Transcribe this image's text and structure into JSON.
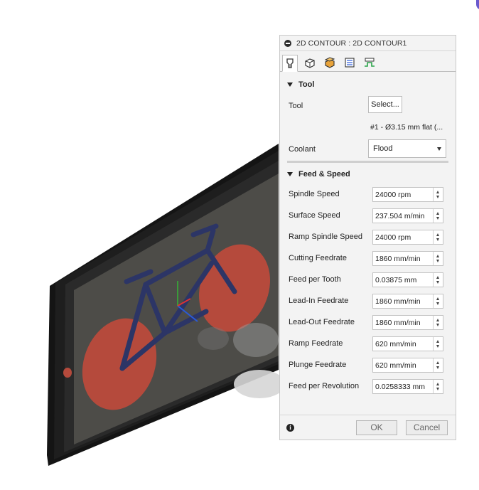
{
  "dialog": {
    "title": "2D CONTOUR : 2D CONTOUR1",
    "tabs": [
      {
        "icon": "tool-icon",
        "active": true
      },
      {
        "icon": "geometry-icon",
        "active": false
      },
      {
        "icon": "heights-icon",
        "active": false
      },
      {
        "icon": "passes-icon",
        "active": false
      },
      {
        "icon": "linking-icon",
        "active": false
      }
    ],
    "tool_section": {
      "heading": "Tool",
      "tool_label": "Tool",
      "select_button": "Select...",
      "tool_info": "#1 - Ø3.15 mm flat (...",
      "coolant_label": "Coolant",
      "coolant_value": "Flood"
    },
    "feed_section": {
      "heading": "Feed & Speed",
      "fields": [
        {
          "label": "Spindle Speed",
          "value": "24000 rpm"
        },
        {
          "label": "Surface Speed",
          "value": "237.504 m/min"
        },
        {
          "label": "Ramp Spindle Speed",
          "value": "24000 rpm"
        },
        {
          "label": "Cutting Feedrate",
          "value": "1860 mm/min"
        },
        {
          "label": "Feed per Tooth",
          "value": "0.03875 mm"
        },
        {
          "label": "Lead-In Feedrate",
          "value": "1860 mm/min"
        },
        {
          "label": "Lead-Out Feedrate",
          "value": "1860 mm/min"
        },
        {
          "label": "Ramp Feedrate",
          "value": "620 mm/min"
        },
        {
          "label": "Plunge Feedrate",
          "value": "620 mm/min"
        },
        {
          "label": "Feed per Revolution",
          "value": "0.0258333 mm"
        }
      ]
    },
    "footer": {
      "ok": "OK",
      "cancel": "Cancel"
    }
  },
  "colors": {
    "wheel": "#b54a3c",
    "frame": "#2c3566",
    "plate": "#4e4d49",
    "border": "#1a1a1a"
  }
}
